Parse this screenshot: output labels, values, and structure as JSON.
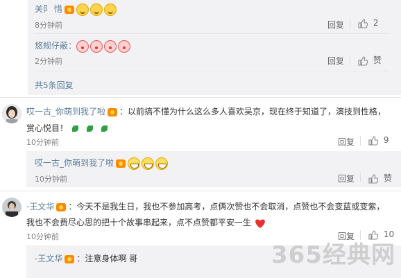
{
  "c1": {
    "name": "关阝 惜",
    "time": "8分钟前",
    "reply": "回复",
    "likes": "2"
  },
  "c2": {
    "name": "悠规仔蔽：",
    "time": "2分钟前",
    "reply": "回复",
    "likes": "赞"
  },
  "more": {
    "label": "共5条回复"
  },
  "post1": {
    "author": "哎一古_你萌到我了啦",
    "text_line1": "：以前搞不懂为什么这么多人喜欢吴京，现在终于知道了，演技到性格，",
    "text_line2": "赏心悦目！",
    "time": "10分钟前",
    "reply": "回复",
    "likes": "9"
  },
  "post1_reply": {
    "name": "哎一古_你萌到我了啦",
    "time": "10分钟前",
    "reply": "回复",
    "likes": "赞"
  },
  "post2": {
    "author": "-王文华",
    "text_line1": "：今天不是我生日，我也不参加高考，点俩次赞也不会取消，点赞也不会变蓝或变紫，",
    "text_line2": "我也不会费尽心思的把十个故事串起来，点不点赞都平安一生",
    "time": "10分钟前",
    "reply": "回复",
    "likes": "10"
  },
  "post2_reply": {
    "name": "-王文华",
    "text": "：注意身体啊 哥"
  },
  "watermark": {
    "brand": "365经典网"
  },
  "colors": {
    "username": "#5a7d9a",
    "badge": "#ff8a00",
    "heart": "#e8322d"
  }
}
